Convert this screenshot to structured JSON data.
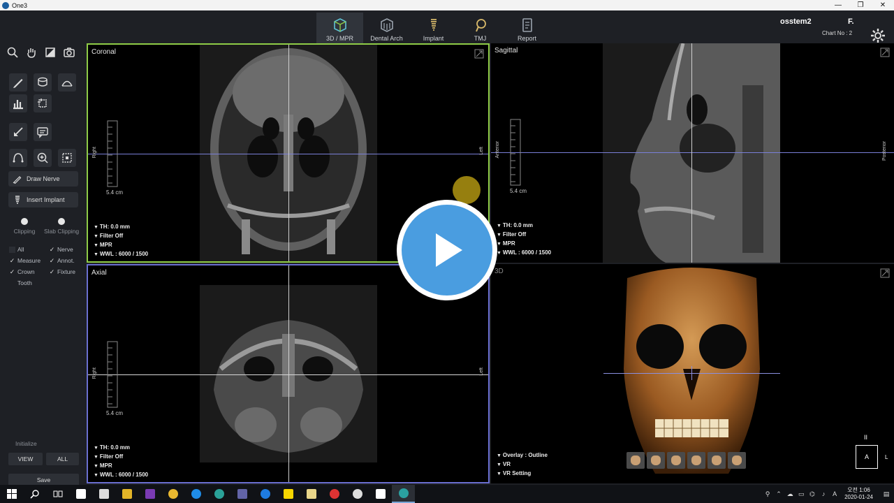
{
  "window": {
    "title": "One3",
    "controls": [
      "—",
      "❐",
      "✕"
    ]
  },
  "header": {
    "modes": [
      {
        "label": "3D / MPR",
        "icon": "mpr-icon",
        "active": true
      },
      {
        "label": "Dental Arch",
        "icon": "dental-arch-icon",
        "active": false
      },
      {
        "label": "Implant",
        "icon": "implant-icon",
        "active": false
      },
      {
        "label": "TMJ",
        "icon": "tmj-icon",
        "active": false
      },
      {
        "label": "Report",
        "icon": "report-icon",
        "active": false
      }
    ],
    "account": "osstem2",
    "account_initial": "F.",
    "chart_no": "Chart No : 2"
  },
  "toolbar": {
    "draw_nerve": "Draw Nerve",
    "insert_implant": "Insert Implant",
    "clipping": "Clipping",
    "slab_clipping": "Slab Clipping",
    "filters": [
      {
        "label": "All",
        "checked": false
      },
      {
        "label": "Nerve",
        "checked": true
      },
      {
        "label": "Measure",
        "checked": true
      },
      {
        "label": "Annot.",
        "checked": true
      },
      {
        "label": "Crown",
        "checked": true
      },
      {
        "label": "Fixture",
        "checked": true
      },
      {
        "label": "Tooth",
        "checked": false
      }
    ],
    "initialize": "Initialize",
    "view_btn": "VIEW",
    "all_btn": "ALL",
    "save_btn": "Save"
  },
  "viewports": {
    "coronal": {
      "title": "Coronal",
      "left_label": "Right",
      "right_label": "Left",
      "scale": "5.4 cm",
      "info": [
        "TH: 0.0 mm",
        "Filter Off",
        "MPR",
        "WWL : 6000 / 1500"
      ]
    },
    "sagittal": {
      "title": "Sagittal",
      "left_label": "Anterior",
      "right_label": "Posterior",
      "scale": "5.4 cm",
      "info": [
        "TH: 0.0 mm",
        "Filter Off",
        "MPR",
        "WWL : 6000 / 1500"
      ]
    },
    "axial": {
      "title": "Axial",
      "left_label": "Right",
      "right_label": "Left",
      "scale": "5.4 cm",
      "info": [
        "TH: 0.0 mm",
        "Filter Off",
        "MPR",
        "WWL : 6000 / 1500"
      ]
    },
    "threed": {
      "title": "3D",
      "info": [
        "Overlay : Outline",
        "VR",
        "VR Setting"
      ],
      "pause": "II",
      "orient_box": "A",
      "orient_side": "L"
    }
  },
  "taskbar": {
    "clock_time": "오전 1:06",
    "clock_date": "2020-01-24",
    "apps": [
      "#ffffff",
      "#ffffff",
      "#ffffff",
      "#c74634",
      "#e8b730",
      "#7a3bb3",
      "#e3b528",
      "#1f8ce6",
      "#2aa198",
      "#6264a7",
      "#1e7be0",
      "#f7d600",
      "#e9d68a",
      "#d33",
      "#ddd",
      "#fff",
      "#2aa0a0"
    ]
  },
  "colors": {
    "coronal_border": "#8fcc47",
    "axial_border": "#6a6fd0",
    "play_blue": "#4a9de0"
  }
}
